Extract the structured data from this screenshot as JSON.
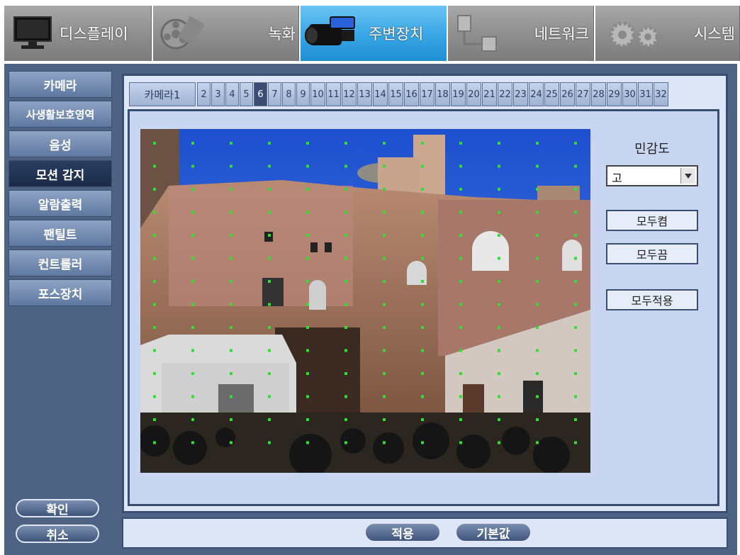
{
  "menu": {
    "display": "디스플레이",
    "record": "녹화",
    "peripherals": "주변장치",
    "network": "네트워크",
    "system": "시스템"
  },
  "sidebar": {
    "items": [
      {
        "label": "카메라"
      },
      {
        "label": "사생활보호영역"
      },
      {
        "label": "음성"
      },
      {
        "label": "모션 감지"
      },
      {
        "label": "알람출력"
      },
      {
        "label": "팬틸트"
      },
      {
        "label": "컨트롤러"
      },
      {
        "label": "포스장치"
      }
    ],
    "selected": "모션 감지",
    "ok_label": "확인",
    "cancel_label": "취소"
  },
  "tabs": {
    "first": "카메라",
    "channels": [
      "1",
      "2",
      "3",
      "4",
      "5",
      "6",
      "7",
      "8",
      "9",
      "10",
      "11",
      "12",
      "13",
      "14",
      "15",
      "16",
      "17",
      "18",
      "19",
      "20",
      "21",
      "22",
      "23",
      "24",
      "25",
      "26",
      "27",
      "28",
      "29",
      "30",
      "31",
      "32"
    ],
    "selected": "6"
  },
  "settings": {
    "sensitivity_label": "민감도",
    "sensitivity_value": "고",
    "all_on": "모두켬",
    "all_off": "모두끔",
    "apply_all": "모두적용"
  },
  "bottom": {
    "apply": "적용",
    "default": "기본값"
  },
  "colors": {
    "panel": "#4e6283",
    "active_tab": "#3b4d72",
    "grid_dot": "#33dd33",
    "menu_active": "#3aa8e6"
  }
}
